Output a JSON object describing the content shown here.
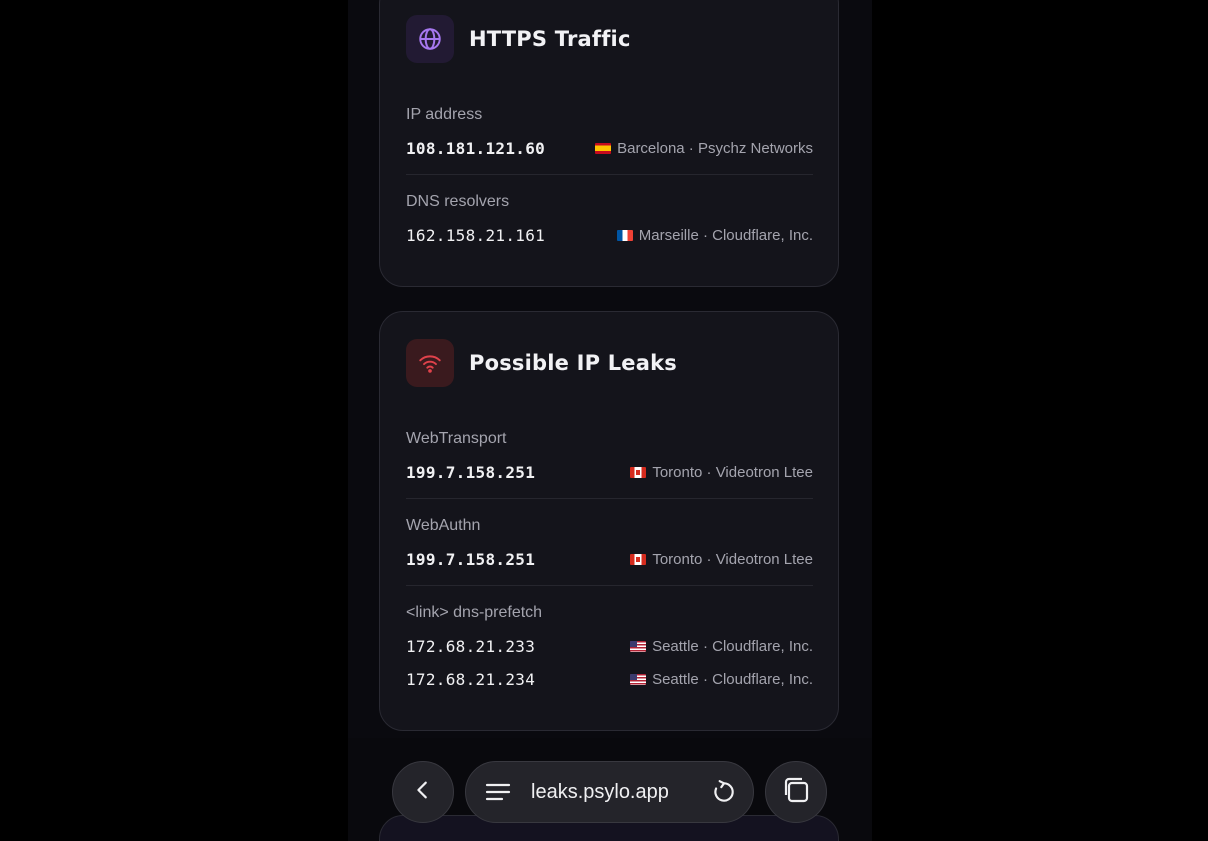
{
  "https_card": {
    "title": "HTTPS Traffic",
    "icon": "globe-icon",
    "sections": [
      {
        "label": "IP address",
        "entries": [
          {
            "ip": "108.181.121.60",
            "flag": "es",
            "location": "Barcelona · Psychz Networks"
          }
        ]
      },
      {
        "label": "DNS resolvers",
        "entries": [
          {
            "ip": "162.158.21.161",
            "flag": "fr",
            "location": "Marseille · Cloudflare, Inc."
          }
        ]
      }
    ]
  },
  "leaks_card": {
    "title": "Possible IP Leaks",
    "icon": "wifi-icon",
    "sections": [
      {
        "label": "WebTransport",
        "entries": [
          {
            "ip": "199.7.158.251",
            "flag": "ca",
            "location": "Toronto · Videotron Ltee"
          }
        ]
      },
      {
        "label": "WebAuthn",
        "entries": [
          {
            "ip": "199.7.158.251",
            "flag": "ca",
            "location": "Toronto · Videotron Ltee"
          }
        ]
      },
      {
        "label": "<link> dns-prefetch",
        "entries": [
          {
            "ip": "172.68.21.233",
            "flag": "us",
            "location": "Seattle · Cloudflare, Inc."
          },
          {
            "ip": "172.68.21.234",
            "flag": "us",
            "location": "Seattle · Cloudflare, Inc."
          }
        ]
      }
    ]
  },
  "browser_bar": {
    "url": "leaks.psylo.app",
    "back_icon": "chevron-left-icon",
    "menu_icon": "menu-icon",
    "reload_icon": "reload-icon",
    "tabs_icon": "tabs-icon"
  },
  "colors": {
    "accent_purple": "#a678f0",
    "accent_red": "#e0424b"
  }
}
